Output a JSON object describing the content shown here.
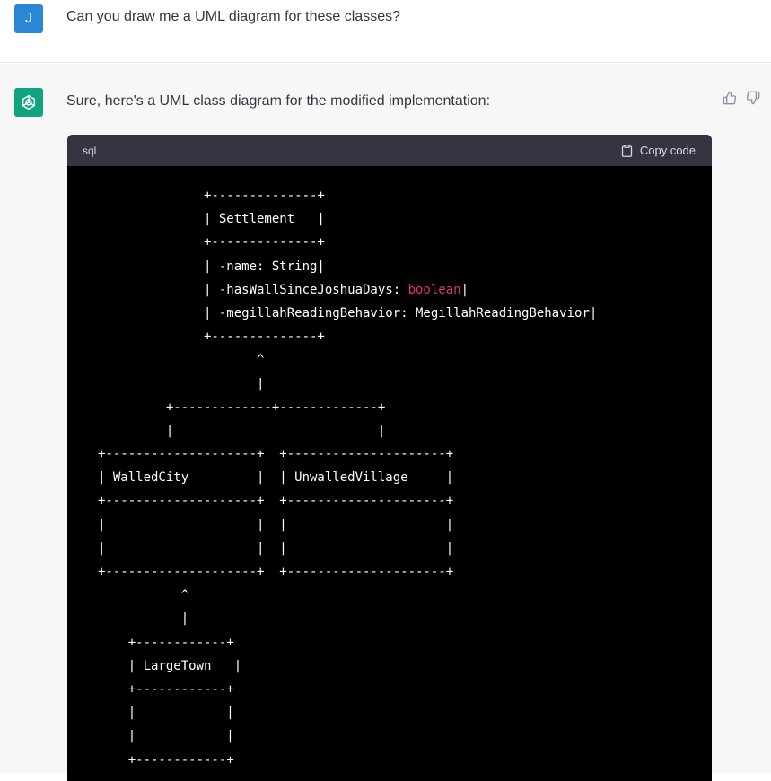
{
  "user_message": {
    "avatar_letter": "J",
    "avatar_color": "#2a86d6",
    "text": "Can you draw me a UML diagram for these classes?"
  },
  "assistant_message": {
    "avatar_color": "#10a37f",
    "avatar_icon": "openai-logo-icon",
    "text": "Sure, here's a UML class diagram for the modified implementation:",
    "feedback": {
      "thumbs_up_icon": "thumbs-up-icon",
      "thumbs_down_icon": "thumbs-down-icon"
    }
  },
  "code_block": {
    "language": "sql",
    "copy_label": "Copy code",
    "lines": [
      {
        "text": "              +--------------+"
      },
      {
        "text": "              | Settlement   |"
      },
      {
        "text": "              +--------------+"
      },
      {
        "text": "              | -name: String|"
      },
      {
        "text": "              | -hasWallSinceJoshuaDays: ",
        "kw": "boolean",
        "after": "|"
      },
      {
        "text": "              | -megillahReadingBehavior: MegillahReadingBehavior|"
      },
      {
        "text": "              +--------------+"
      },
      {
        "text": "                     ^"
      },
      {
        "text": "                     |"
      },
      {
        "text": "         +-------------+-------------+"
      },
      {
        "text": "         |                           |"
      },
      {
        "text": "+--------------------+  +---------------------+"
      },
      {
        "text": "| WalledCity         |  | UnwalledVillage     |"
      },
      {
        "text": "+--------------------+  +---------------------+"
      },
      {
        "text": "|                    |  |                     |"
      },
      {
        "text": "|                    |  |                     |"
      },
      {
        "text": "+--------------------+  +---------------------+"
      },
      {
        "text": "           ^"
      },
      {
        "text": "           |"
      },
      {
        "text": "    +------------+"
      },
      {
        "text": "    | LargeTown   |"
      },
      {
        "text": "    +------------+"
      },
      {
        "text": "    |            |"
      },
      {
        "text": "    |            |"
      },
      {
        "text": "    +------------+"
      }
    ]
  }
}
